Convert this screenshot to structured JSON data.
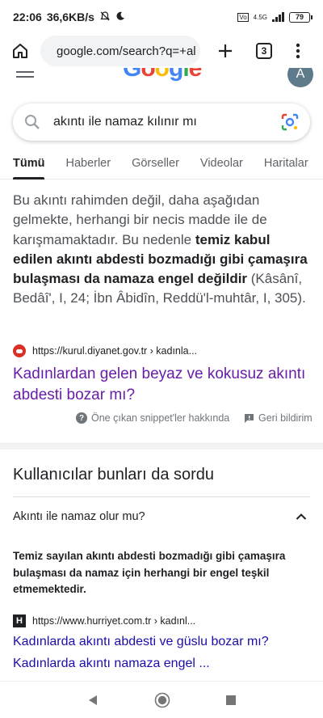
{
  "status_bar": {
    "time": "22:06",
    "speed": "36,6KB/s",
    "network": "4.5G",
    "battery": "79"
  },
  "browser": {
    "url": "google.com/search?q=+al",
    "tab_count": "3"
  },
  "google": {
    "logo_letters": [
      "G",
      "o",
      "o",
      "g",
      "l",
      "e"
    ],
    "avatar_letter": "A"
  },
  "search": {
    "query": "akıntı ile namaz kılınır mı"
  },
  "tabs": [
    "Tümü",
    "Haberler",
    "Görseller",
    "Videolar",
    "Haritalar"
  ],
  "snippet": {
    "text_1": "Bu akıntı rahimden değil, daha aşağıdan gelmekte, herhangi bir necis madde ile de karışmamaktadır. Bu nedenle ",
    "text_bold": "temiz kabul edilen akıntı abdesti bozmadığı gibi çamaşıra bulaşması da namaza engel değildir",
    "text_2": " (Kâsânî, Bedâî', I, 24; İbn Âbidîn, Reddü'l-muhtâr, I, 305).",
    "source": "https://kurul.diyanet.gov.tr › kadınla...",
    "title": "Kadınlardan gelen beyaz ve kokusuz akıntı abdesti bozar mı?",
    "about_label": "Öne çıkan snippet'ler hakkında",
    "feedback_label": "Geri bildirim"
  },
  "paa": {
    "title": "Kullanıcılar bunları da sordu",
    "question": "Akıntı ile namaz olur mu?",
    "answer": "Temiz sayılan akıntı abdesti bozmadığı gibi çamaşıra bulaşması da namaz için herhangi bir engel teşkil etmemektedir.",
    "source": "https://www.hurriyet.com.tr › kadınl...",
    "favicon_letter": "H",
    "link_1": "Kadınlarda akıntı abdesti ve güslu bozar mı?",
    "link_2": "Kadınlarda akıntı namaza engel ..."
  },
  "colors": {
    "link_visited": "#681da8",
    "link": "#1a0dab",
    "text": "#202124",
    "muted": "#4d5156"
  }
}
